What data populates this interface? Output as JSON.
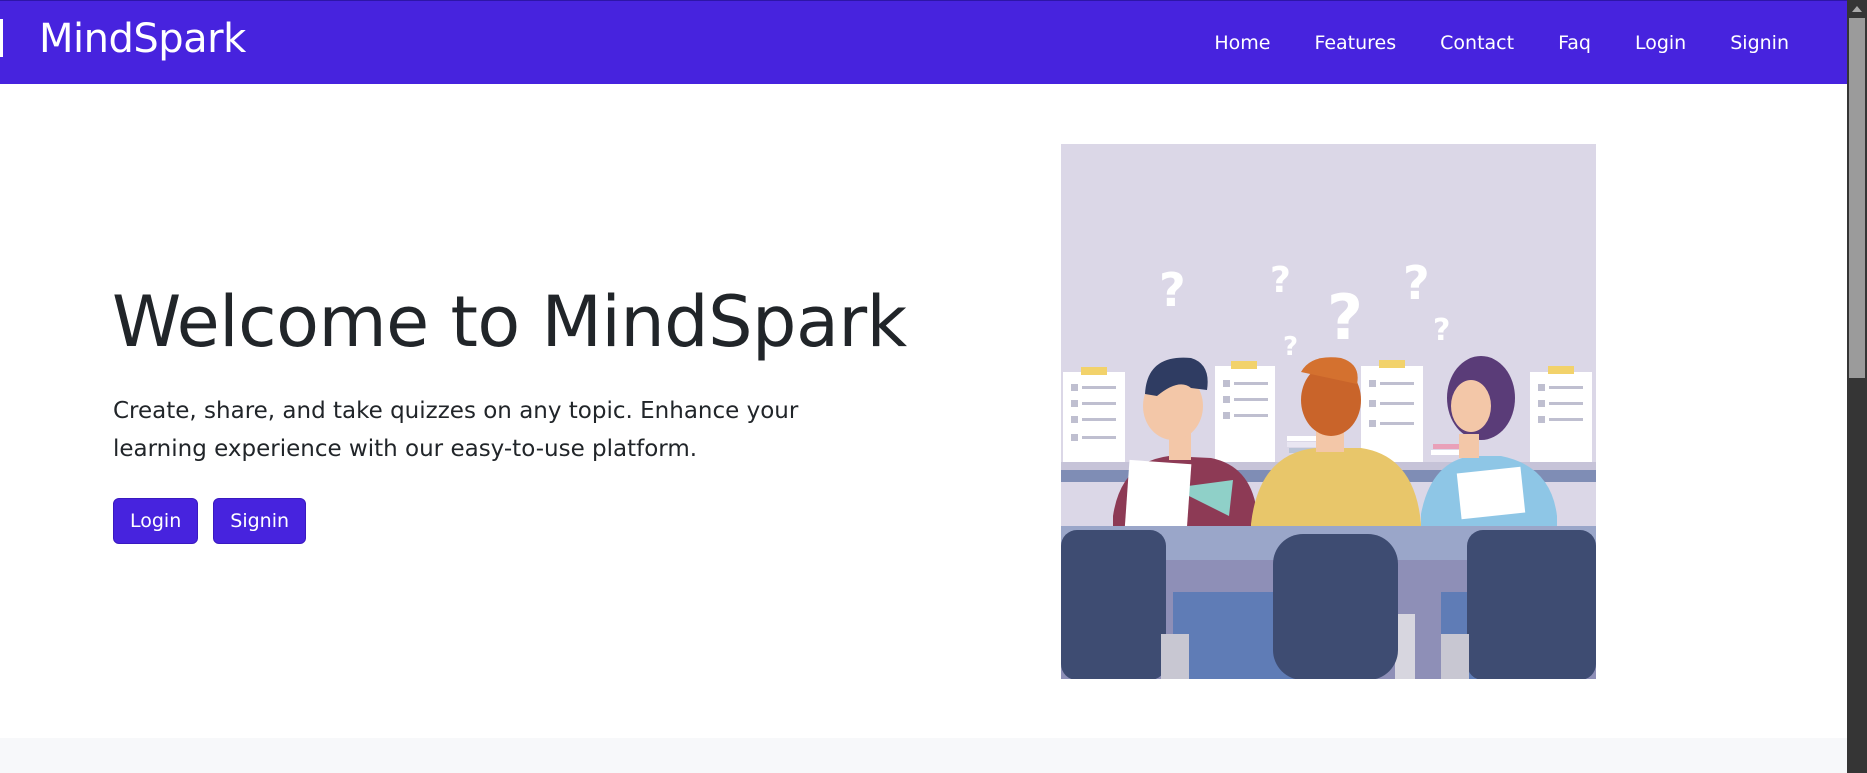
{
  "nav": {
    "brand": "MindSpark",
    "links": [
      "Home",
      "Features",
      "Contact",
      "Faq",
      "Login",
      "Signin"
    ]
  },
  "hero": {
    "title": "Welcome to MindSpark",
    "lead": "Create, share, and take quizzes on any topic. Enhance your learning experience with our easy-to-use platform.",
    "login_label": "Login",
    "signin_label": "Signin"
  },
  "illustration": {
    "description_icon": "students-taking-quiz-illustration"
  },
  "colors": {
    "brand": "#4723de",
    "text": "#212529",
    "footer_band": "#f7f8fa"
  }
}
